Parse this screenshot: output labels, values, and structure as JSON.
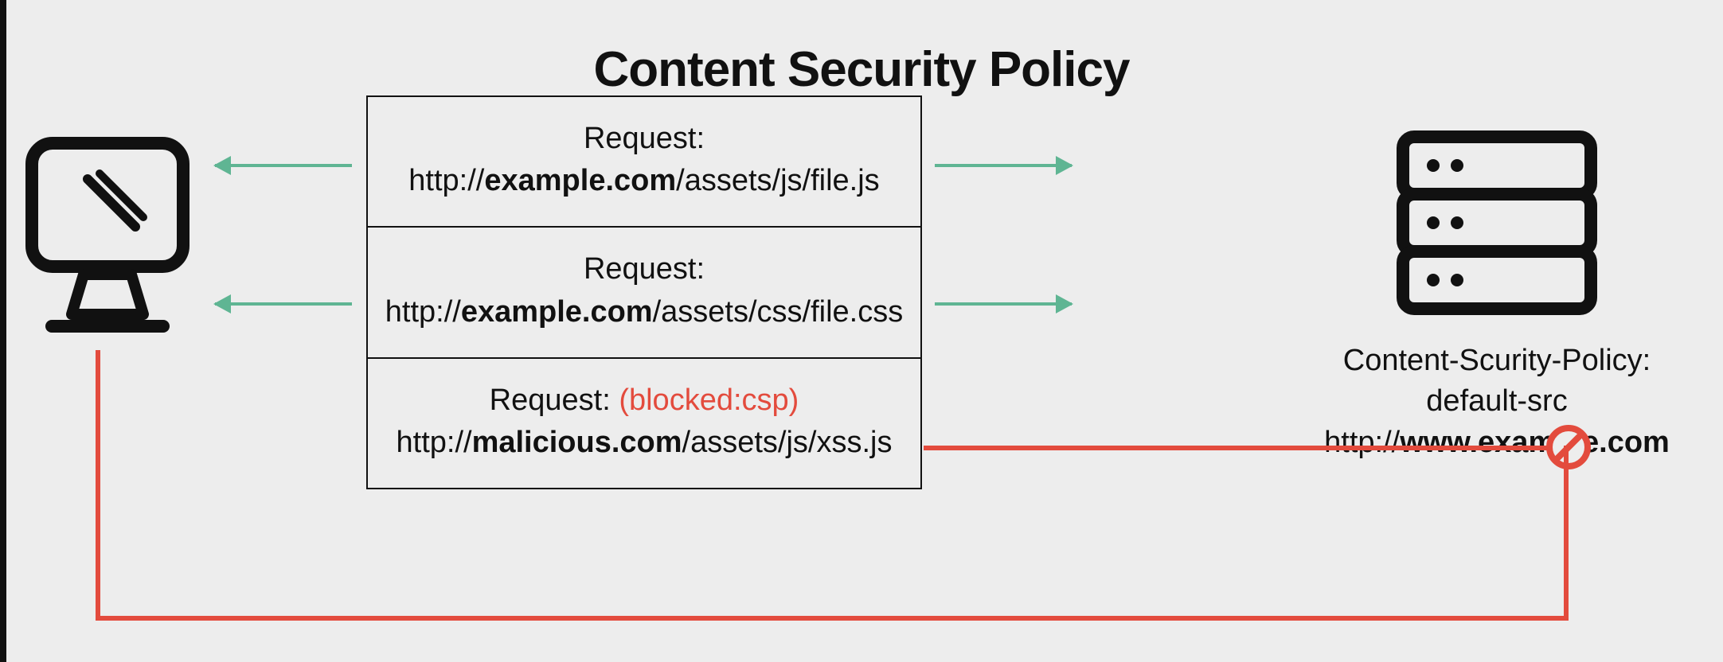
{
  "title": "Content Security Policy",
  "colors": {
    "allowed": "#5fb593",
    "blocked": "#e34b3d"
  },
  "requests": [
    {
      "label": "Request:",
      "url_prefix": "http://",
      "url_host": "example.com",
      "url_path": "/assets/js/file.js",
      "blocked_tag": "",
      "status": "allowed"
    },
    {
      "label": "Request:",
      "url_prefix": "http://",
      "url_host": "example.com",
      "url_path": "/assets/css/file.css",
      "blocked_tag": "",
      "status": "allowed"
    },
    {
      "label": "Request: ",
      "url_prefix": "http://",
      "url_host": "malicious.com",
      "url_path": "/assets/js/xss.js",
      "blocked_tag": "(blocked:csp)",
      "status": "blocked"
    }
  ],
  "server_caption": {
    "line1": "Content-Scurity-Policy:",
    "line2_prefix": "default-src http://",
    "line2_bold": "www.example.com"
  },
  "nodes": {
    "client": "client-monitor-icon",
    "server": "server-rack-icon"
  }
}
